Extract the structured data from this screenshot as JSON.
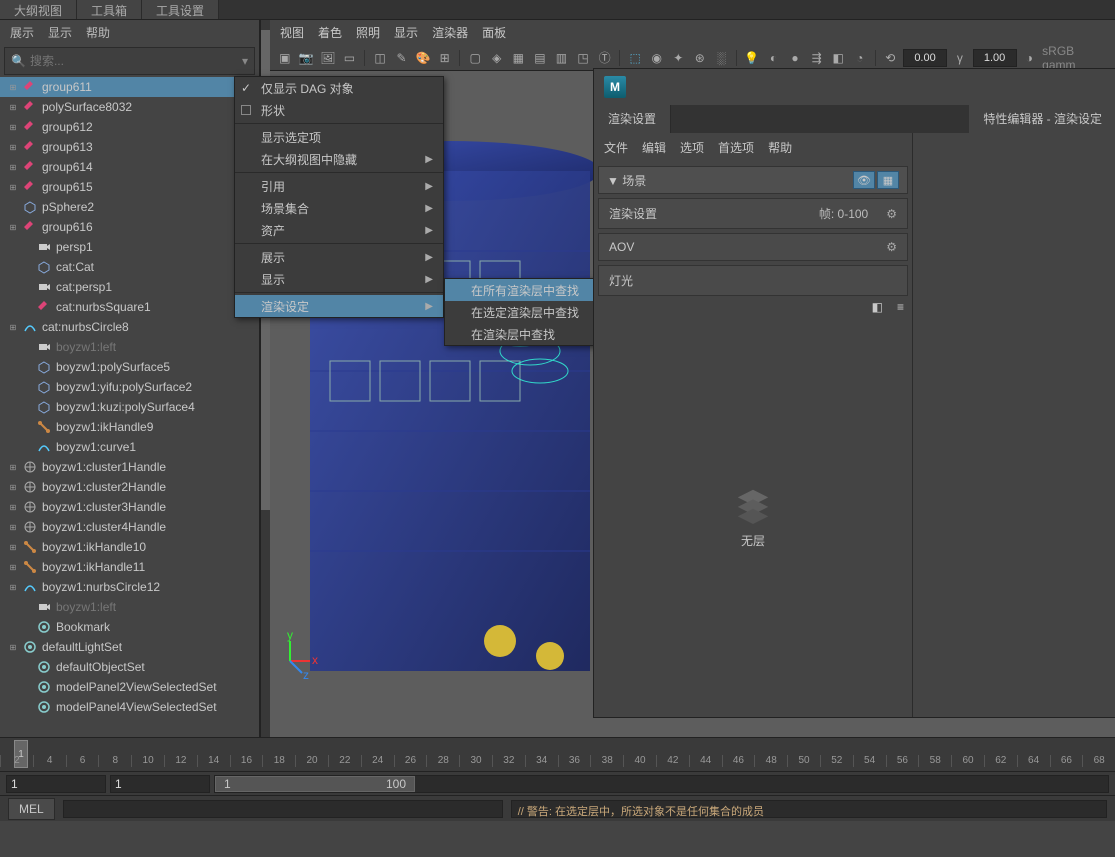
{
  "topTabs": {
    "outliner": "大纲视图",
    "toolbox": "工具箱",
    "toolSettings": "工具设置"
  },
  "leftMenu": {
    "show": "展示",
    "display": "显示",
    "help": "帮助"
  },
  "search": {
    "placeholder": "搜索..."
  },
  "outliner": [
    {
      "name": "group611",
      "icon": "transform",
      "exp": "+",
      "selected": true,
      "indent": 0
    },
    {
      "name": "polySurface8032",
      "icon": "transform",
      "exp": "+",
      "indent": 0
    },
    {
      "name": "group612",
      "icon": "transform",
      "exp": "+",
      "indent": 0
    },
    {
      "name": "group613",
      "icon": "transform",
      "exp": "+",
      "indent": 0
    },
    {
      "name": "group614",
      "icon": "transform",
      "exp": "+",
      "indent": 0
    },
    {
      "name": "group615",
      "icon": "transform",
      "exp": "+",
      "indent": 0
    },
    {
      "name": "pSphere2",
      "icon": "mesh",
      "indent": 0
    },
    {
      "name": "group616",
      "icon": "transform",
      "exp": "+",
      "indent": 0
    },
    {
      "name": "persp1",
      "icon": "camera",
      "indent": 1
    },
    {
      "name": "cat:Cat",
      "icon": "mesh",
      "indent": 1
    },
    {
      "name": "cat:persp1",
      "icon": "camera",
      "indent": 1
    },
    {
      "name": "cat:nurbsSquare1",
      "icon": "transform",
      "indent": 1
    },
    {
      "name": "cat:nurbsCircle8",
      "icon": "curve",
      "exp": "+",
      "indent": 0
    },
    {
      "name": "boyzw1:left",
      "icon": "camera",
      "indent": 1,
      "dim": true
    },
    {
      "name": "boyzw1:polySurface5",
      "icon": "mesh",
      "indent": 1
    },
    {
      "name": "boyzw1:yifu:polySurface2",
      "icon": "mesh",
      "indent": 1
    },
    {
      "name": "boyzw1:kuzi:polySurface4",
      "icon": "mesh",
      "indent": 1
    },
    {
      "name": "boyzw1:ikHandle9",
      "icon": "ik",
      "indent": 1
    },
    {
      "name": "boyzw1:curve1",
      "icon": "curve",
      "indent": 1
    },
    {
      "name": "boyzw1:cluster1Handle",
      "icon": "cluster",
      "exp": "+",
      "indent": 0
    },
    {
      "name": "boyzw1:cluster2Handle",
      "icon": "cluster",
      "exp": "+",
      "indent": 0
    },
    {
      "name": "boyzw1:cluster3Handle",
      "icon": "cluster",
      "exp": "+",
      "indent": 0
    },
    {
      "name": "boyzw1:cluster4Handle",
      "icon": "cluster",
      "exp": "+",
      "indent": 0
    },
    {
      "name": "boyzw1:ikHandle10",
      "icon": "ik",
      "exp": "+",
      "indent": 0
    },
    {
      "name": "boyzw1:ikHandle11",
      "icon": "ik",
      "exp": "+",
      "indent": 0
    },
    {
      "name": "boyzw1:nurbsCircle12",
      "icon": "curve",
      "exp": "+",
      "indent": 0
    },
    {
      "name": "boyzw1:left",
      "icon": "camera",
      "indent": 1,
      "dim": true
    },
    {
      "name": "Bookmark",
      "icon": "set",
      "indent": 1
    },
    {
      "name": "defaultLightSet",
      "icon": "set",
      "exp": "+",
      "indent": 0
    },
    {
      "name": "defaultObjectSet",
      "icon": "set",
      "indent": 1
    },
    {
      "name": "modelPanel2ViewSelectedSet",
      "icon": "set",
      "indent": 1
    },
    {
      "name": "modelPanel4ViewSelectedSet",
      "icon": "set",
      "indent": 1
    }
  ],
  "viewportMenu": {
    "view": "视图",
    "shading": "着色",
    "lighting": "照明",
    "show": "显示",
    "renderer": "渲染器",
    "panels": "面板"
  },
  "viewportToolbar": {
    "expo": "0.00",
    "gamma": "1.00",
    "colorspace": "sRGB gamm"
  },
  "ctx1": [
    {
      "label": "仅显示 DAG 对象",
      "check": true
    },
    {
      "label": "形状",
      "box": true
    },
    {
      "sep": true
    },
    {
      "label": "显示选定项"
    },
    {
      "label": "在大纲视图中隐藏",
      "arrow": true
    },
    {
      "sep": true
    },
    {
      "label": "引用",
      "arrow": true
    },
    {
      "label": "场景集合",
      "arrow": true
    },
    {
      "label": "资产",
      "arrow": true
    },
    {
      "sep": true
    },
    {
      "label": "展示",
      "arrow": true
    },
    {
      "label": "显示",
      "arrow": true
    },
    {
      "sep": true
    },
    {
      "label": "渲染设定",
      "arrow": true,
      "active": true
    }
  ],
  "ctx2": [
    {
      "label": "在所有渲染层中查找",
      "active": true
    },
    {
      "label": "在选定渲染层中查找"
    },
    {
      "label": "在渲染层中查找",
      "arrow": true
    }
  ],
  "renderDlg": {
    "tab1": "渲染设置",
    "tab2": "特性编辑器 - 渲染设定",
    "menu": {
      "file": "文件",
      "edit": "编辑",
      "options": "选项",
      "prefs": "首选项",
      "help": "帮助"
    },
    "sceneHeader": "场景",
    "rowRender": "渲染设置",
    "rowFrames": "帧: 0-100",
    "rowAOV": "AOV",
    "rowLights": "灯光",
    "noLayers": "无层"
  },
  "timeline": {
    "ticks": [
      "2",
      "4",
      "6",
      "8",
      "10",
      "12",
      "14",
      "16",
      "18",
      "20",
      "22",
      "24",
      "26",
      "28",
      "30",
      "32",
      "34",
      "36",
      "38",
      "40",
      "42",
      "44",
      "46",
      "48",
      "50",
      "52",
      "54",
      "56",
      "58",
      "60",
      "62",
      "64",
      "66",
      "68"
    ],
    "playhead": "1"
  },
  "range": {
    "start": "1",
    "startInner": "1",
    "thumbStart": "1",
    "thumbEnd": "100"
  },
  "cmd": {
    "label": "MEL",
    "status": "// 警告: 在选定层中，所选对象不是任何集合的成员"
  }
}
